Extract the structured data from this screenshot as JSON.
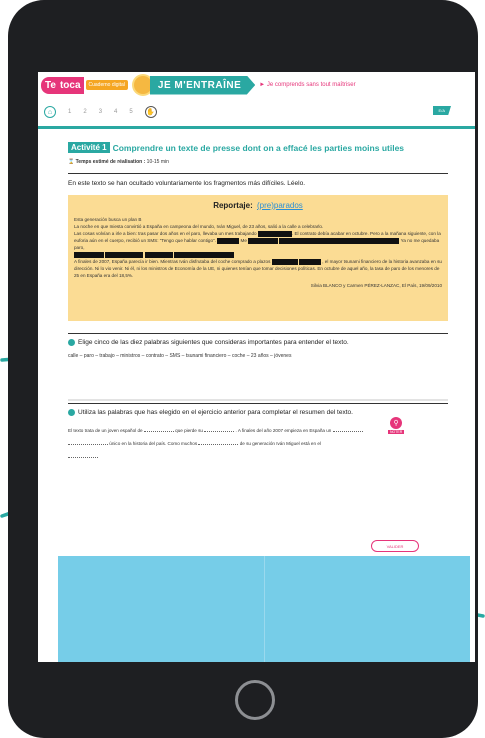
{
  "brand": {
    "logo_te": "Te",
    "logo_toca": "toca",
    "logo_sub": "Cuaderno digital",
    "banner": "JE M'ENTRAÎNE",
    "breadcrumb": "► Je comprends sans tout maîtriser",
    "right_tag": "E/A"
  },
  "steps": [
    "1",
    "2",
    "3",
    "4",
    "5"
  ],
  "activity": {
    "badge": "Activité 1",
    "title": "Comprendre un texte de presse dont on a effacé les parties moins utiles",
    "time_label": "Temps estimé de réalisation :",
    "time_value": "10-15 min",
    "intro": "En este texto se han ocultado voluntariamente los fragmentos más difíciles. Léelo."
  },
  "article": {
    "title": "Reportaje:",
    "title_blank": "(pre)parados",
    "lines": [
      "Esta generación busca un plan B",
      "La noche en que Iniesta convirtió a España en campeona del mundo, Iván Miguel, de 23 años, salió a la calle a celebrarlo.",
      "Las cosas volvían a irle a bien: tras pasar dos años en el paro, llevaba un mes trabajando",
      "El contrato debía acabar en octubre. Pero a la mañana siguiente, con la euforia aún en el cuerpo, recibió un SMS: \"Tengo que hablar contigo\".",
      "Me",
      "Ya no me quedaba paro,",
      "A finales de 2007, España parecía ir bien. Mientras Iván disfrutaba del coche comprado a plazos",
      ", el mayor tsunami financiero de la historia avanzaba en su dirección. Ni lo vio venir. Ni él, ni los ministros de Economía de la UE, ni quienes tenían que tomar decisiones políticas. En octubre de aquel año, la tasa de paro de los menores de 25 en España era del 18,5%."
    ],
    "source": "Silvia BLANCO y Carmen PÉREZ-LANZAC, El País, 19/09/2010"
  },
  "question1": {
    "text": "Elige cinco de las diez palabras siguientes que consideras importantes para entender el texto.",
    "words": "calle – paro – trabajo – ministros – contrato – SMS – tsunami financiero – coche – 23 años – jóvenes"
  },
  "pin": {
    "label": "NOTER"
  },
  "question2": {
    "text": "Utiliza las palabras que has elegido en el ejercicio anterior para completar el resumen del texto.",
    "p1": "El texto trata de un joven español de",
    "p2": "que pierde su",
    "p3": ". A finales del año 2007 empieza en España un",
    "p4": "único en la historia del país. Como muchos",
    "p5": "de su generación Iván Miguel está en el"
  },
  "validate_label": "VALIDER",
  "colors": {
    "accent": "#2aa8a2",
    "pink": "#e6357a",
    "article_bg": "#fbdc94",
    "panel_blue": "#76cde8"
  }
}
